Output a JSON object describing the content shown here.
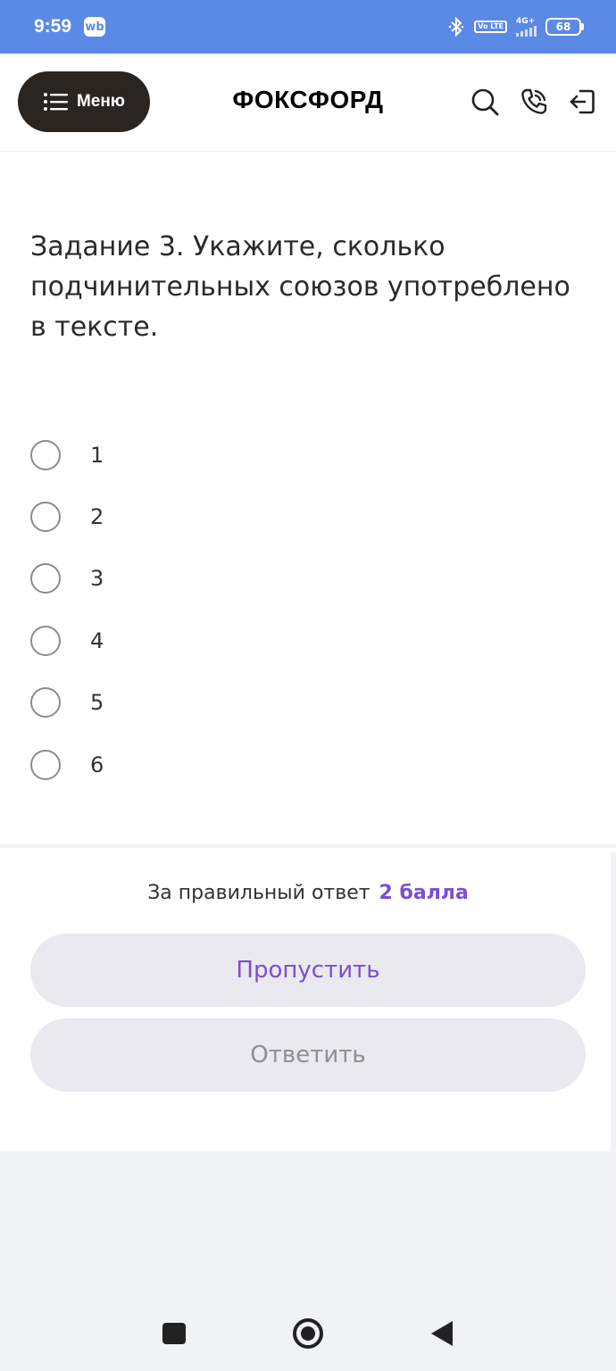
{
  "status_bar": {
    "time": "9:59",
    "app_badge": "wb",
    "volte": "Vo LTE",
    "network": "4G+",
    "battery": "68"
  },
  "header": {
    "menu_label": "Меню",
    "logo": "ФОКСФОРД",
    "icons": [
      "search-icon",
      "phone-icon",
      "logout-icon"
    ]
  },
  "task": {
    "question": "Задание 3. Укажите, сколько подчинительных союзов употреблено в тексте.",
    "options": [
      "1",
      "2",
      "3",
      "4",
      "5",
      "6"
    ]
  },
  "footer": {
    "points_label": "За правильный ответ",
    "points_value": "2 балла",
    "skip_label": "Пропустить",
    "answer_label": "Ответить"
  },
  "colors": {
    "status_bar": "#5b89e6",
    "accent": "#7a4fd1",
    "menu_button": "#2b2521",
    "button_bg": "#e9e9ef"
  }
}
